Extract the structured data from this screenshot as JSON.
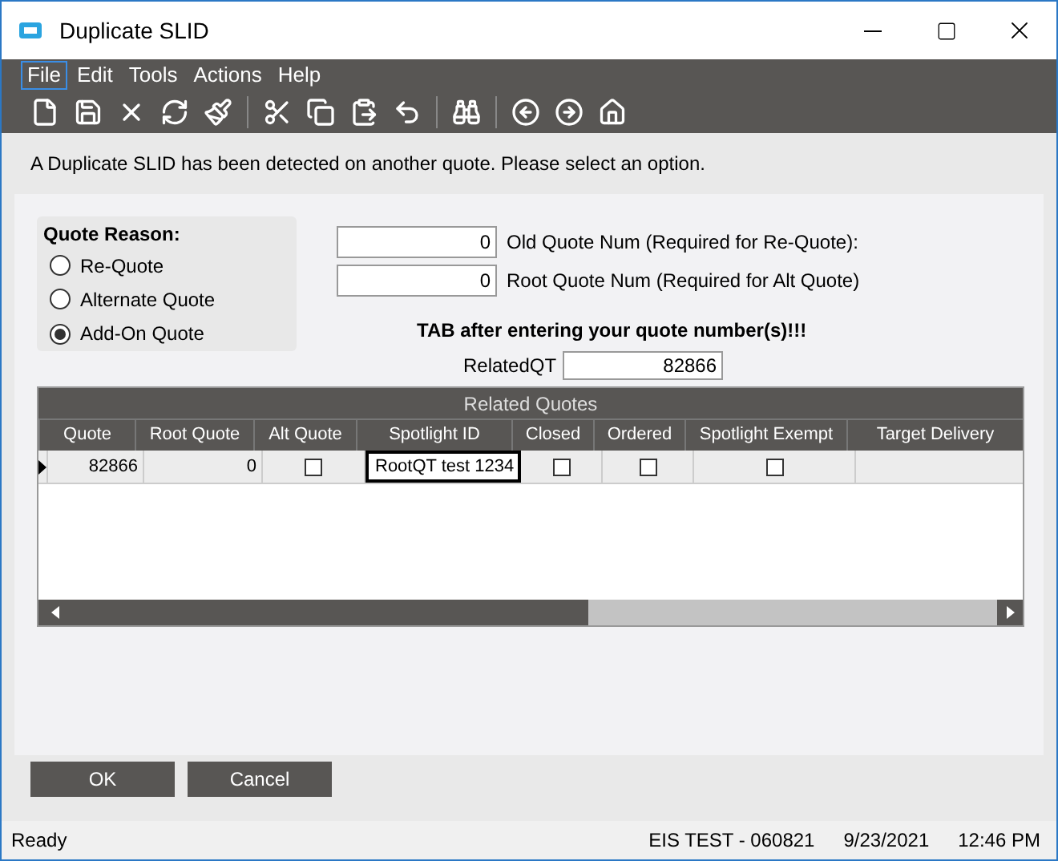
{
  "window": {
    "title": "Duplicate SLID"
  },
  "menu": [
    {
      "label": "File",
      "selected": true
    },
    {
      "label": "Edit",
      "selected": false
    },
    {
      "label": "Tools",
      "selected": false
    },
    {
      "label": "Actions",
      "selected": false
    },
    {
      "label": "Help",
      "selected": false
    }
  ],
  "message": "A Duplicate SLID has been detected on another quote. Please select an option.",
  "quote_reason": {
    "title": "Quote Reason:",
    "options": [
      {
        "label": "Re-Quote",
        "selected": false
      },
      {
        "label": "Alternate Quote",
        "selected": false
      },
      {
        "label": "Add-On Quote",
        "selected": true
      }
    ]
  },
  "fields": [
    {
      "value": "0",
      "label": "Old Quote Num (Required for Re-Quote):"
    },
    {
      "value": "0",
      "label": "Root Quote Num (Required for Alt Quote)"
    }
  ],
  "instruction": "TAB after entering your quote number(s)!!!",
  "related_qt": {
    "label": "RelatedQT",
    "value": "82866"
  },
  "grid": {
    "title": "Related Quotes",
    "columns": [
      "Quote",
      "Root Quote",
      "Alt Quote",
      "Spotlight ID",
      "Closed",
      "Ordered",
      "Spotlight Exempt",
      "Target Delivery"
    ],
    "rows": [
      {
        "current": true,
        "cells": [
          {
            "kind": "number",
            "text": "82866"
          },
          {
            "kind": "number",
            "text": "0"
          },
          {
            "kind": "checkbox",
            "checked": false
          },
          {
            "kind": "edit",
            "text": "RootQT test 1234"
          },
          {
            "kind": "checkbox",
            "checked": false
          },
          {
            "kind": "checkbox",
            "checked": false
          },
          {
            "kind": "checkbox",
            "checked": false
          },
          {
            "kind": "empty"
          }
        ]
      }
    ]
  },
  "buttons": [
    "OK",
    "Cancel"
  ],
  "status_bar": {
    "status": "Ready",
    "items": [
      "EIS TEST - 060821",
      "9/23/2021",
      "12:46 PM"
    ]
  }
}
